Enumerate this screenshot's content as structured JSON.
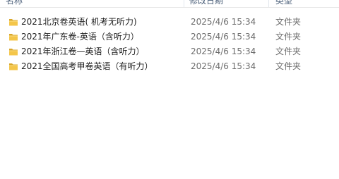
{
  "header": {
    "name_label": "名称",
    "date_label": "修改日期",
    "type_label": "类型"
  },
  "colors": {
    "folder_back": "#d9a72a",
    "folder_front": "#f4c64a",
    "header_text": "#4c607a",
    "meta_text": "#6d6d6d"
  },
  "files": [
    {
      "icon": "folder-icon",
      "name": "2021北京卷英语( 机考无听力)",
      "date": "2025/4/6 15:34",
      "type": "文件夹"
    },
    {
      "icon": "folder-icon",
      "name": "2021年广东卷-英语（含听力）",
      "date": "2025/4/6 15:34",
      "type": "文件夹"
    },
    {
      "icon": "folder-icon",
      "name": "2021年浙江卷—英语（含听力）",
      "date": "2025/4/6 15:34",
      "type": "文件夹"
    },
    {
      "icon": "folder-icon",
      "name": "2021全国高考甲卷英语（有听力）",
      "date": "2025/4/6 15:34",
      "type": "文件夹"
    }
  ]
}
